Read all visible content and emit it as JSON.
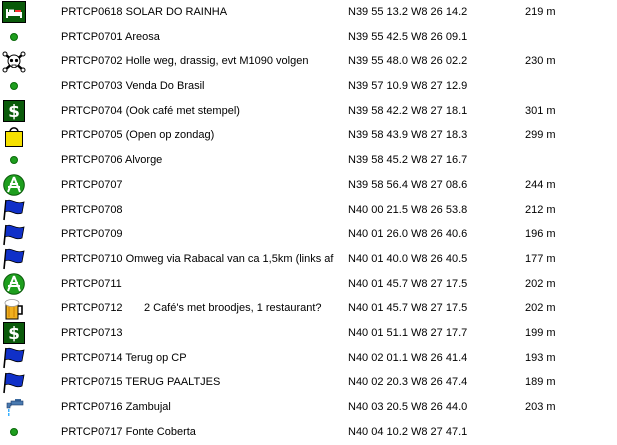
{
  "waypoints": [
    {
      "icon": "lodging-icon",
      "name": "PRTCP0618 SOLAR DO RAINHA",
      "coord": "N39 55 13.2 W8 26 14.2",
      "altitude": "219 m"
    },
    {
      "icon": "waypoint-dot-icon",
      "name": "PRTCP0701 Areosa",
      "coord": "N39 55 42.5 W8 26 09.1",
      "altitude": ""
    },
    {
      "icon": "skull-crossbones-icon",
      "name": "PRTCP0702 Holle weg, drassig, evt M1090 volgen",
      "coord": "N39 55 48.0 W8 26 02.2",
      "altitude": "230 m"
    },
    {
      "icon": "waypoint-dot-icon",
      "name": "PRTCP0703 Venda Do Brasil",
      "coord": "N39 57 10.9 W8 27 12.9",
      "altitude": ""
    },
    {
      "icon": "dollar-bank-icon",
      "name": "PRTCP0704 (Ook café met stempel)",
      "coord": "N39 58 42.2 W8 27 18.1",
      "altitude": "301 m"
    },
    {
      "icon": "shopping-bag-icon",
      "name": "PRTCP0705 (Open op zondag)",
      "coord": "N39 58 43.9 W8 27 18.3",
      "altitude": "299 m"
    },
    {
      "icon": "waypoint-dot-icon",
      "name": "PRTCP0706 Alvorge",
      "coord": "N39 58 45.2 W8 27 16.7",
      "altitude": ""
    },
    {
      "icon": "picnic-area-icon",
      "name": "PRTCP0707",
      "coord": "N39 58 56.4 W8 27 08.6",
      "altitude": "244 m"
    },
    {
      "icon": "blue-flag-icon",
      "name": "PRTCP0708",
      "coord": "N40 00 21.5 W8 26 53.8",
      "altitude": "212 m"
    },
    {
      "icon": "blue-flag-icon",
      "name": "PRTCP0709",
      "coord": "N40 01 26.0 W8 26 40.6",
      "altitude": "196 m"
    },
    {
      "icon": "blue-flag-icon",
      "name": "PRTCP0710 Omweg via Rabacal van ca 1,5km (links af",
      "coord": "N40 01 40.0 W8 26 40.5",
      "altitude": "177 m"
    },
    {
      "icon": "picnic-area-icon",
      "name": "PRTCP0711",
      "coord": "N40 01 45.7 W8 27 17.5",
      "altitude": "202 m"
    },
    {
      "icon": "beer-mug-icon",
      "name": "PRTCP0712       2 Café's met broodjes, 1 restaurant?",
      "coord": "N40 01 45.7 W8 27 17.5",
      "altitude": "202 m"
    },
    {
      "icon": "dollar-bank-icon",
      "name": "PRTCP0713",
      "coord": "N40 01 51.1 W8 27 17.7",
      "altitude": "199 m"
    },
    {
      "icon": "blue-flag-icon",
      "name": "PRTCP0714 Terug op CP",
      "coord": "N40 02 01.1 W8 26 41.4",
      "altitude": "193 m"
    },
    {
      "icon": "blue-flag-icon",
      "name": "PRTCP0715 TERUG PAALTJES",
      "coord": "N40 02 20.3 W8 26 47.4",
      "altitude": "189 m"
    },
    {
      "icon": "water-tap-icon",
      "name": "PRTCP0716 Zambujal",
      "coord": "N40 03 20.5 W8 26 44.0",
      "altitude": "203 m"
    },
    {
      "icon": "waypoint-dot-icon",
      "name": "PRTCP0717 Fonte Coberta",
      "coord": "N40 04 10.2 W8 27 47.1",
      "altitude": ""
    }
  ],
  "colors": {
    "text": "#000000",
    "green": "#1e9e1e",
    "dark_green": "#0a5a0a",
    "flag_blue": "#1030c8",
    "bag_yellow": "#f5e000"
  }
}
